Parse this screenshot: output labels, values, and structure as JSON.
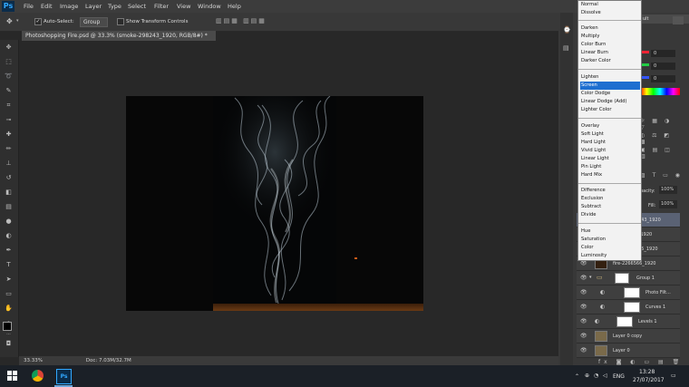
{
  "app": {
    "logo": "Ps"
  },
  "menu": [
    "File",
    "Edit",
    "Image",
    "Layer",
    "Type",
    "Select",
    "Filter",
    "View",
    "Window",
    "Help"
  ],
  "options": {
    "auto_select_label": "Auto-Select:",
    "auto_select_value": "Group",
    "transform_label": "Show Transform Controls"
  },
  "document": {
    "tab_title": "Photoshopping Fire.psd @ 33.3% (smoke-298243_1920, RGB/8#) *",
    "tab_close": "×"
  },
  "status": {
    "zoom": "33.33%",
    "doc_size": "Doc: 7.03M/32.7M"
  },
  "color_panel": {
    "values": [
      "0",
      "0",
      "0"
    ]
  },
  "layers_panel": {
    "opacity_label": "pacity:",
    "opacity_value": "100%",
    "fill_label": "Fill:",
    "fill_value": "100%",
    "layers": [
      {
        "name": "243_1920"
      },
      {
        "name": "_1920"
      },
      {
        "name": "35_1920"
      },
      {
        "name": "fire-2266566_1920"
      },
      {
        "name": "Group 1"
      },
      {
        "name": "Photo Filt..."
      },
      {
        "name": "Curves 1"
      },
      {
        "name": "Levels 1"
      },
      {
        "name": "Layer 0 copy"
      },
      {
        "name": "Layer 0"
      }
    ],
    "top_right_label": "ult"
  },
  "blend_modes": {
    "selected": "Screen",
    "groups": [
      [
        "Normal",
        "Dissolve"
      ],
      [
        "Darken",
        "Multiply",
        "Color Burn",
        "Linear Burn",
        "Darker Color"
      ],
      [
        "Lighten",
        "Screen",
        "Color Dodge",
        "Linear Dodge (Add)",
        "Lighter Color"
      ],
      [
        "Overlay",
        "Soft Light",
        "Hard Light",
        "Vivid Light",
        "Linear Light",
        "Pin Light",
        "Hard Mix"
      ],
      [
        "Difference",
        "Exclusion",
        "Subtract",
        "Divide"
      ],
      [
        "Hue",
        "Saturation",
        "Color",
        "Luminosity"
      ]
    ]
  },
  "taskbar": {
    "lang": "ENG",
    "time": "13:28",
    "date": "27/07/2017"
  },
  "colors": {
    "accent": "#1e6fd0",
    "ps_blue": "#31a8ff",
    "foreground": "#000000",
    "background": "#ffffff"
  }
}
